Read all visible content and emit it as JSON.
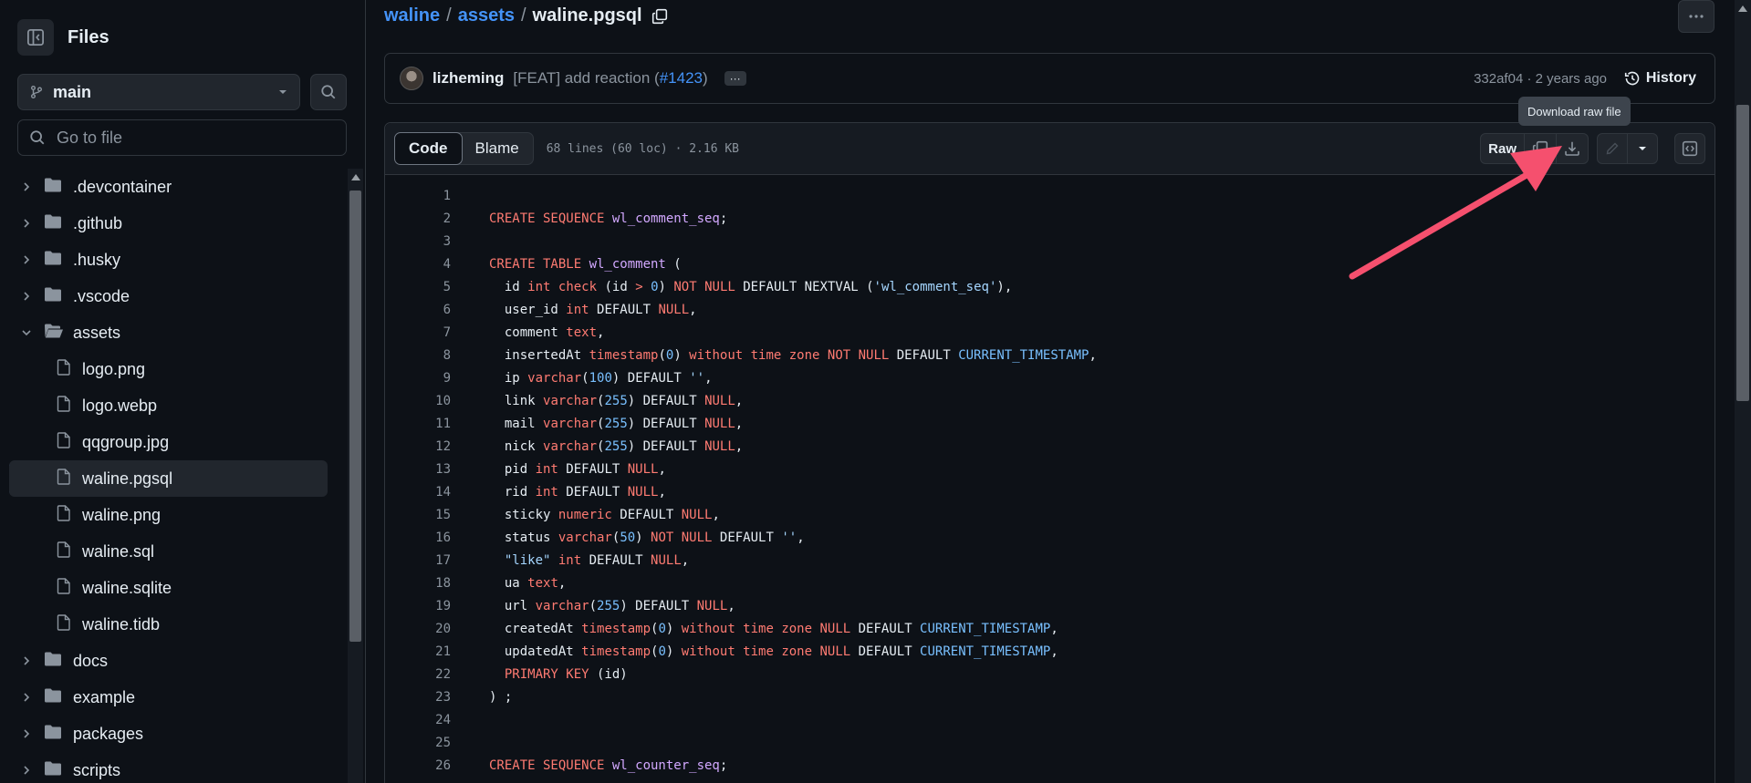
{
  "sidebar": {
    "title": "Files",
    "branch": "main",
    "goto_placeholder": "Go to file",
    "items": [
      {
        "label": ".devcontainer",
        "type": "folder",
        "expanded": false
      },
      {
        "label": ".github",
        "type": "folder",
        "expanded": false
      },
      {
        "label": ".husky",
        "type": "folder",
        "expanded": false
      },
      {
        "label": ".vscode",
        "type": "folder",
        "expanded": false
      },
      {
        "label": "assets",
        "type": "folder",
        "expanded": true
      },
      {
        "label": "logo.png",
        "type": "file"
      },
      {
        "label": "logo.webp",
        "type": "file"
      },
      {
        "label": "qqgroup.jpg",
        "type": "file"
      },
      {
        "label": "waline.pgsql",
        "type": "file",
        "selected": true
      },
      {
        "label": "waline.png",
        "type": "file"
      },
      {
        "label": "waline.sql",
        "type": "file"
      },
      {
        "label": "waline.sqlite",
        "type": "file"
      },
      {
        "label": "waline.tidb",
        "type": "file"
      },
      {
        "label": "docs",
        "type": "folder",
        "expanded": false
      },
      {
        "label": "example",
        "type": "folder",
        "expanded": false
      },
      {
        "label": "packages",
        "type": "folder",
        "expanded": false
      },
      {
        "label": "scripts",
        "type": "folder",
        "expanded": false
      }
    ]
  },
  "breadcrumb": {
    "repo": "waline",
    "dir": "assets",
    "file": "waline.pgsql",
    "separator": "/"
  },
  "commit": {
    "author": "lizheming",
    "message": "[FEAT] add reaction (",
    "pr": "#1423",
    "message_end": ")",
    "ellipsis": "···",
    "hash_age": "332af04 · 2 years ago",
    "history_label": "History"
  },
  "tooltip": "Download raw file",
  "file_header": {
    "code_tab": "Code",
    "blame_tab": "Blame",
    "info": "68 lines (60 loc) · 2.16 KB",
    "raw_label": "Raw"
  },
  "code_lines": [
    {
      "n": "1",
      "tokens": []
    },
    {
      "n": "2",
      "tokens": [
        [
          "kw",
          "CREATE SEQUENCE "
        ],
        [
          "id",
          "wl_comment_seq"
        ],
        [
          "plain",
          ";"
        ]
      ]
    },
    {
      "n": "3",
      "tokens": []
    },
    {
      "n": "4",
      "tokens": [
        [
          "kw",
          "CREATE TABLE "
        ],
        [
          "id",
          "wl_comment"
        ],
        [
          "plain",
          " ("
        ]
      ]
    },
    {
      "n": "5",
      "tokens": [
        [
          "plain",
          "  id "
        ],
        [
          "kw",
          "int"
        ],
        [
          "plain",
          " "
        ],
        [
          "kw",
          "check"
        ],
        [
          "plain",
          " (id "
        ],
        [
          "kw",
          ">"
        ],
        [
          "plain",
          " "
        ],
        [
          "num",
          "0"
        ],
        [
          "plain",
          ") "
        ],
        [
          "kw",
          "NOT NULL"
        ],
        [
          "plain",
          " DEFAULT NEXTVAL ("
        ],
        [
          "str",
          "'wl_comment_seq'"
        ],
        [
          "plain",
          "),"
        ]
      ]
    },
    {
      "n": "6",
      "tokens": [
        [
          "plain",
          "  user_id "
        ],
        [
          "kw",
          "int"
        ],
        [
          "plain",
          " DEFAULT "
        ],
        [
          "kw",
          "NULL"
        ],
        [
          "plain",
          ","
        ]
      ]
    },
    {
      "n": "7",
      "tokens": [
        [
          "plain",
          "  comment "
        ],
        [
          "kw",
          "text"
        ],
        [
          "plain",
          ","
        ]
      ]
    },
    {
      "n": "8",
      "tokens": [
        [
          "plain",
          "  insertedAt "
        ],
        [
          "kw",
          "timestamp"
        ],
        [
          "plain",
          "("
        ],
        [
          "num",
          "0"
        ],
        [
          "plain",
          ") "
        ],
        [
          "kw",
          "without time zone NOT NULL"
        ],
        [
          "plain",
          " DEFAULT "
        ],
        [
          "num",
          "CURRENT_TIMESTAMP"
        ],
        [
          "plain",
          ","
        ]
      ]
    },
    {
      "n": "9",
      "tokens": [
        [
          "plain",
          "  ip "
        ],
        [
          "kw",
          "varchar"
        ],
        [
          "plain",
          "("
        ],
        [
          "num",
          "100"
        ],
        [
          "plain",
          ") DEFAULT "
        ],
        [
          "str",
          "''"
        ],
        [
          "plain",
          ","
        ]
      ]
    },
    {
      "n": "10",
      "tokens": [
        [
          "plain",
          "  link "
        ],
        [
          "kw",
          "varchar"
        ],
        [
          "plain",
          "("
        ],
        [
          "num",
          "255"
        ],
        [
          "plain",
          ") DEFAULT "
        ],
        [
          "kw",
          "NULL"
        ],
        [
          "plain",
          ","
        ]
      ]
    },
    {
      "n": "11",
      "tokens": [
        [
          "plain",
          "  mail "
        ],
        [
          "kw",
          "varchar"
        ],
        [
          "plain",
          "("
        ],
        [
          "num",
          "255"
        ],
        [
          "plain",
          ") DEFAULT "
        ],
        [
          "kw",
          "NULL"
        ],
        [
          "plain",
          ","
        ]
      ]
    },
    {
      "n": "12",
      "tokens": [
        [
          "plain",
          "  nick "
        ],
        [
          "kw",
          "varchar"
        ],
        [
          "plain",
          "("
        ],
        [
          "num",
          "255"
        ],
        [
          "plain",
          ") DEFAULT "
        ],
        [
          "kw",
          "NULL"
        ],
        [
          "plain",
          ","
        ]
      ]
    },
    {
      "n": "13",
      "tokens": [
        [
          "plain",
          "  pid "
        ],
        [
          "kw",
          "int"
        ],
        [
          "plain",
          " DEFAULT "
        ],
        [
          "kw",
          "NULL"
        ],
        [
          "plain",
          ","
        ]
      ]
    },
    {
      "n": "14",
      "tokens": [
        [
          "plain",
          "  rid "
        ],
        [
          "kw",
          "int"
        ],
        [
          "plain",
          " DEFAULT "
        ],
        [
          "kw",
          "NULL"
        ],
        [
          "plain",
          ","
        ]
      ]
    },
    {
      "n": "15",
      "tokens": [
        [
          "plain",
          "  sticky "
        ],
        [
          "kw",
          "numeric"
        ],
        [
          "plain",
          " DEFAULT "
        ],
        [
          "kw",
          "NULL"
        ],
        [
          "plain",
          ","
        ]
      ]
    },
    {
      "n": "16",
      "tokens": [
        [
          "plain",
          "  status "
        ],
        [
          "kw",
          "varchar"
        ],
        [
          "plain",
          "("
        ],
        [
          "num",
          "50"
        ],
        [
          "plain",
          ") "
        ],
        [
          "kw",
          "NOT NULL"
        ],
        [
          "plain",
          " DEFAULT "
        ],
        [
          "str",
          "''"
        ],
        [
          "plain",
          ","
        ]
      ]
    },
    {
      "n": "17",
      "tokens": [
        [
          "str",
          "  \"like\""
        ],
        [
          "plain",
          " "
        ],
        [
          "kw",
          "int"
        ],
        [
          "plain",
          " DEFAULT "
        ],
        [
          "kw",
          "NULL"
        ],
        [
          "plain",
          ","
        ]
      ]
    },
    {
      "n": "18",
      "tokens": [
        [
          "plain",
          "  ua "
        ],
        [
          "kw",
          "text"
        ],
        [
          "plain",
          ","
        ]
      ]
    },
    {
      "n": "19",
      "tokens": [
        [
          "plain",
          "  url "
        ],
        [
          "kw",
          "varchar"
        ],
        [
          "plain",
          "("
        ],
        [
          "num",
          "255"
        ],
        [
          "plain",
          ") DEFAULT "
        ],
        [
          "kw",
          "NULL"
        ],
        [
          "plain",
          ","
        ]
      ]
    },
    {
      "n": "20",
      "tokens": [
        [
          "plain",
          "  createdAt "
        ],
        [
          "kw",
          "timestamp"
        ],
        [
          "plain",
          "("
        ],
        [
          "num",
          "0"
        ],
        [
          "plain",
          ") "
        ],
        [
          "kw",
          "without time zone NULL"
        ],
        [
          "plain",
          " DEFAULT "
        ],
        [
          "num",
          "CURRENT_TIMESTAMP"
        ],
        [
          "plain",
          ","
        ]
      ]
    },
    {
      "n": "21",
      "tokens": [
        [
          "plain",
          "  updatedAt "
        ],
        [
          "kw",
          "timestamp"
        ],
        [
          "plain",
          "("
        ],
        [
          "num",
          "0"
        ],
        [
          "plain",
          ") "
        ],
        [
          "kw",
          "without time zone NULL"
        ],
        [
          "plain",
          " DEFAULT "
        ],
        [
          "num",
          "CURRENT_TIMESTAMP"
        ],
        [
          "plain",
          ","
        ]
      ]
    },
    {
      "n": "22",
      "tokens": [
        [
          "kw",
          "  PRIMARY KEY"
        ],
        [
          "plain",
          " (id)"
        ]
      ]
    },
    {
      "n": "23",
      "tokens": [
        [
          "plain",
          ") ;"
        ]
      ]
    },
    {
      "n": "24",
      "tokens": []
    },
    {
      "n": "25",
      "tokens": []
    },
    {
      "n": "26",
      "tokens": [
        [
          "kw",
          "CREATE SEQUENCE "
        ],
        [
          "id",
          "wl_counter_seq"
        ],
        [
          "plain",
          ";"
        ]
      ]
    }
  ],
  "colors": {
    "accent": "#4493f8",
    "annotation_arrow": "#f5506e"
  }
}
